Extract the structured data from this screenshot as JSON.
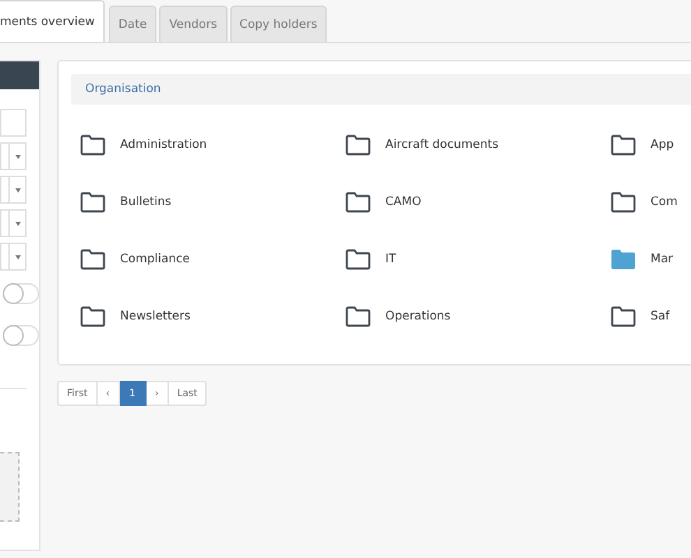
{
  "tabs": [
    {
      "label": "ments overview",
      "selected": true
    },
    {
      "label": "Date",
      "selected": false
    },
    {
      "label": "Vendors",
      "selected": false
    },
    {
      "label": "Copy holders",
      "selected": false
    }
  ],
  "filter_panel": {
    "fields": [
      {
        "kind": "input"
      },
      {
        "kind": "select"
      },
      {
        "kind": "select"
      },
      {
        "kind": "select"
      },
      {
        "kind": "select"
      }
    ],
    "toggles": [
      {
        "on": false
      },
      {
        "on": false
      }
    ]
  },
  "folders": {
    "title": "Organisation",
    "items": [
      {
        "label": "Administration",
        "selected": false
      },
      {
        "label": "Aircraft documents",
        "selected": false
      },
      {
        "label": "App",
        "selected": false
      },
      {
        "label": "Bulletins",
        "selected": false
      },
      {
        "label": "CAMO",
        "selected": false
      },
      {
        "label": "Com",
        "selected": false
      },
      {
        "label": "Compliance",
        "selected": false
      },
      {
        "label": "IT",
        "selected": false
      },
      {
        "label": "Mar",
        "selected": true
      },
      {
        "label": "Newsletters",
        "selected": false
      },
      {
        "label": "Operations",
        "selected": false
      },
      {
        "label": "Saf",
        "selected": false
      }
    ]
  },
  "pagination": [
    {
      "label": "First",
      "selected": false
    },
    {
      "label": "‹",
      "selected": false
    },
    {
      "label": "1",
      "selected": true
    },
    {
      "label": "›",
      "selected": false
    },
    {
      "label": "Last",
      "selected": false
    }
  ]
}
